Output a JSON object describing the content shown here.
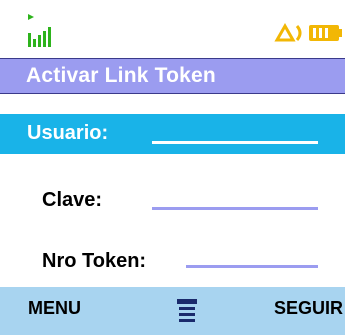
{
  "title": "Activar Link Token",
  "status": {
    "signal_icon": "signal-strength-icon",
    "network_icon": "network-arrows-icon",
    "battery_icon": "battery-icon",
    "colors": {
      "signal": "#2db31c",
      "accent": "#f2b705"
    }
  },
  "form": {
    "user_label": "Usuario:",
    "user_value": "",
    "password_label": "Clave:",
    "password_value": "",
    "token_label": "Nro Token:",
    "token_value": ""
  },
  "softkeys": {
    "left_label": "MENU",
    "center_icon": "menu-icon",
    "right_label": "SEGUIR"
  },
  "colors": {
    "title_bar": "#9b9cf0",
    "selected_row": "#19b3e8",
    "softkey_bar": "#a8d4f0"
  }
}
